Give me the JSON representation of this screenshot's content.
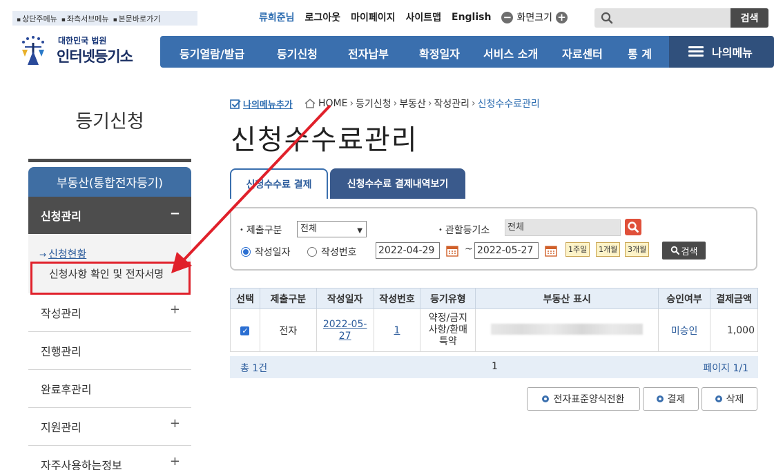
{
  "skip_links": [
    "상단주메뉴",
    "좌측서브메뉴",
    "본문바로가기"
  ],
  "logo": {
    "sub": "대한민국 법원",
    "main": "인터넷등기소"
  },
  "util": {
    "user": "류희준님",
    "logout": "로그아웃",
    "mypage": "마이페이지",
    "sitemap": "사이트맵",
    "english": "English",
    "zoom_label": "화면크기"
  },
  "search": {
    "placeholder": "",
    "button": "검색"
  },
  "gnb": [
    "등기열람/발급",
    "등기신청",
    "전자납부",
    "확정일자",
    "서비스 소개",
    "자료센터",
    "통 계"
  ],
  "my_menu": "나의메뉴",
  "lnb": {
    "title": "등기신청",
    "head": "부동산(통합전자등기)",
    "active": "신청관리",
    "sub_items": [
      "신청현황",
      "신청사항 확인 및 전자서명"
    ],
    "items": [
      "작성관리",
      "진행관리",
      "완료후관리",
      "지원관리",
      "자주사용하는정보"
    ]
  },
  "breadcrumb": {
    "add": "나의메뉴추가",
    "path": [
      "HOME",
      "등기신청",
      "부동산",
      "작성관리",
      "신청수수료관리"
    ]
  },
  "page_title": "신청수수료관리",
  "tabs": [
    "신청수수료 결제",
    "신청수수료 결제내역보기"
  ],
  "filter": {
    "submit_type_label": "제출구분",
    "submit_type_value": "전체",
    "office_label": "관할등기소",
    "office_value": "전체",
    "radio_date": "작성일자",
    "radio_number": "작성번호",
    "date_from": "2022-04-29",
    "date_to": "2022-05-27",
    "tilde": "~",
    "periods": [
      "1주일",
      "1개월",
      "3개월"
    ],
    "search": "검색"
  },
  "table": {
    "headers": [
      "선택",
      "제출구분",
      "작성일자",
      "작성번호",
      "등기유형",
      "부동산 표시",
      "승인여부",
      "결제금액"
    ],
    "rows": [
      {
        "type": "전자",
        "date": "2022-05-27",
        "number": "1",
        "kind": "약정/금지사항/환매특약",
        "status": "미승인",
        "amount": "1,000"
      }
    ]
  },
  "table_footer": {
    "total": "총 1건",
    "page": "1",
    "pages": "페이지 1/1"
  },
  "actions": [
    "전자표준양식전환",
    "결제",
    "삭제"
  ],
  "colors": {
    "nav_blue": "#3a6fae",
    "my_menu": "#30507c",
    "annotation_red": "#e0202a",
    "dark": "#4d4d4d"
  }
}
